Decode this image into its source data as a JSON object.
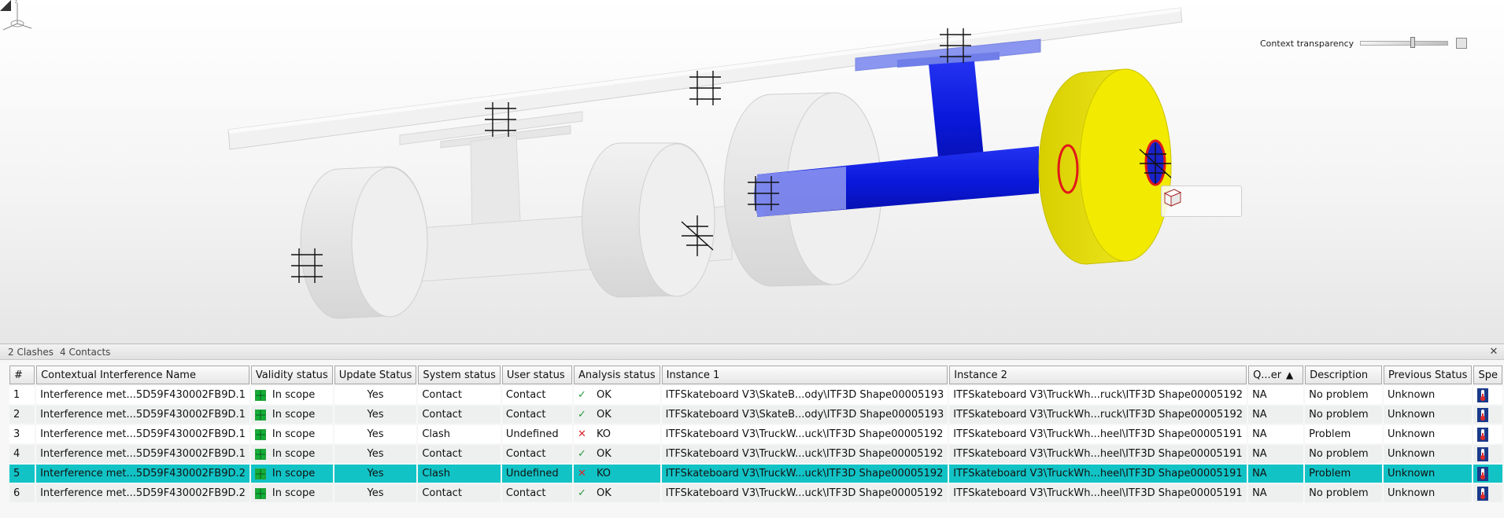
{
  "viewport": {
    "context_transparency_label": "Context transparency",
    "view_tools": [
      "wireframe-cube-icon",
      "shaded-cube-icon",
      "edges-cube-icon"
    ],
    "colors": {
      "clash_blue": "#0a18dc",
      "wheel_yellow": "#f2ea00",
      "clash_edge": "#e01818"
    }
  },
  "panel": {
    "title_clashes": "2 Clashes",
    "title_contacts": "4 Contacts",
    "columns": [
      "#",
      "Contextual Interference Name",
      "Validity status",
      "Update Status",
      "System status",
      "User status",
      "Analysis status",
      "Instance 1",
      "Instance 2",
      "Q...er",
      "Description",
      "Previous Status",
      "Spe"
    ],
    "rows": [
      {
        "num": "1",
        "name": "Interference met...5D59F430002FB9D.1",
        "validity": "In scope",
        "update": "Yes",
        "system": "Contact",
        "user": "Contact",
        "analysis_mark": "✓",
        "analysis": "OK",
        "instance1": "ITFSkateboard V3\\SkateB...ody\\ITF3D Shape00005193",
        "instance2": "ITFSkateboard V3\\TruckWh...ruck\\ITF3D Shape00005192",
        "qualifier": "NA",
        "description": "No problem",
        "previous": "Unknown"
      },
      {
        "num": "2",
        "name": "Interference met...5D59F430002FB9D.1",
        "validity": "In scope",
        "update": "Yes",
        "system": "Contact",
        "user": "Contact",
        "analysis_mark": "✓",
        "analysis": "OK",
        "instance1": "ITFSkateboard V3\\SkateB...ody\\ITF3D Shape00005193",
        "instance2": "ITFSkateboard V3\\TruckWh...ruck\\ITF3D Shape00005192",
        "qualifier": "NA",
        "description": "No problem",
        "previous": "Unknown"
      },
      {
        "num": "3",
        "name": "Interference met...5D59F430002FB9D.1",
        "validity": "In scope",
        "update": "Yes",
        "system": "Clash",
        "user": "Undefined",
        "analysis_mark": "✕",
        "analysis": "KO",
        "instance1": "ITFSkateboard V3\\TruckW...uck\\ITF3D Shape00005192",
        "instance2": "ITFSkateboard V3\\TruckWh...heel\\ITF3D Shape00005191",
        "qualifier": "NA",
        "description": "Problem",
        "previous": "Unknown"
      },
      {
        "num": "4",
        "name": "Interference met...5D59F430002FB9D.1",
        "validity": "In scope",
        "update": "Yes",
        "system": "Contact",
        "user": "Contact",
        "analysis_mark": "✓",
        "analysis": "OK",
        "instance1": "ITFSkateboard V3\\TruckW...uck\\ITF3D Shape00005192",
        "instance2": "ITFSkateboard V3\\TruckWh...heel\\ITF3D Shape00005191",
        "qualifier": "NA",
        "description": "No problem",
        "previous": "Unknown"
      },
      {
        "num": "5",
        "name": "Interference met...5D59F430002FB9D.2",
        "validity": "In scope",
        "update": "Yes",
        "system": "Clash",
        "user": "Undefined",
        "analysis_mark": "✕",
        "analysis": "KO",
        "instance1": "ITFSkateboard V3\\TruckW...uck\\ITF3D Shape00005192",
        "instance2": "ITFSkateboard V3\\TruckWh...heel\\ITF3D Shape00005191",
        "qualifier": "NA",
        "description": "Problem",
        "previous": "Unknown"
      },
      {
        "num": "6",
        "name": "Interference met...5D59F430002FB9D.2",
        "validity": "In scope",
        "update": "Yes",
        "system": "Contact",
        "user": "Contact",
        "analysis_mark": "✓",
        "analysis": "OK",
        "instance1": "ITFSkateboard V3\\TruckW...uck\\ITF3D Shape00005192",
        "instance2": "ITFSkateboard V3\\TruckWh...heel\\ITF3D Shape00005191",
        "qualifier": "NA",
        "description": "No problem",
        "previous": "Unknown"
      }
    ],
    "selected_row": "5",
    "colors": {
      "selected_row": "#12c3c6",
      "ok_mark": "#2c9a3e",
      "ko_mark": "#d9262b"
    }
  }
}
